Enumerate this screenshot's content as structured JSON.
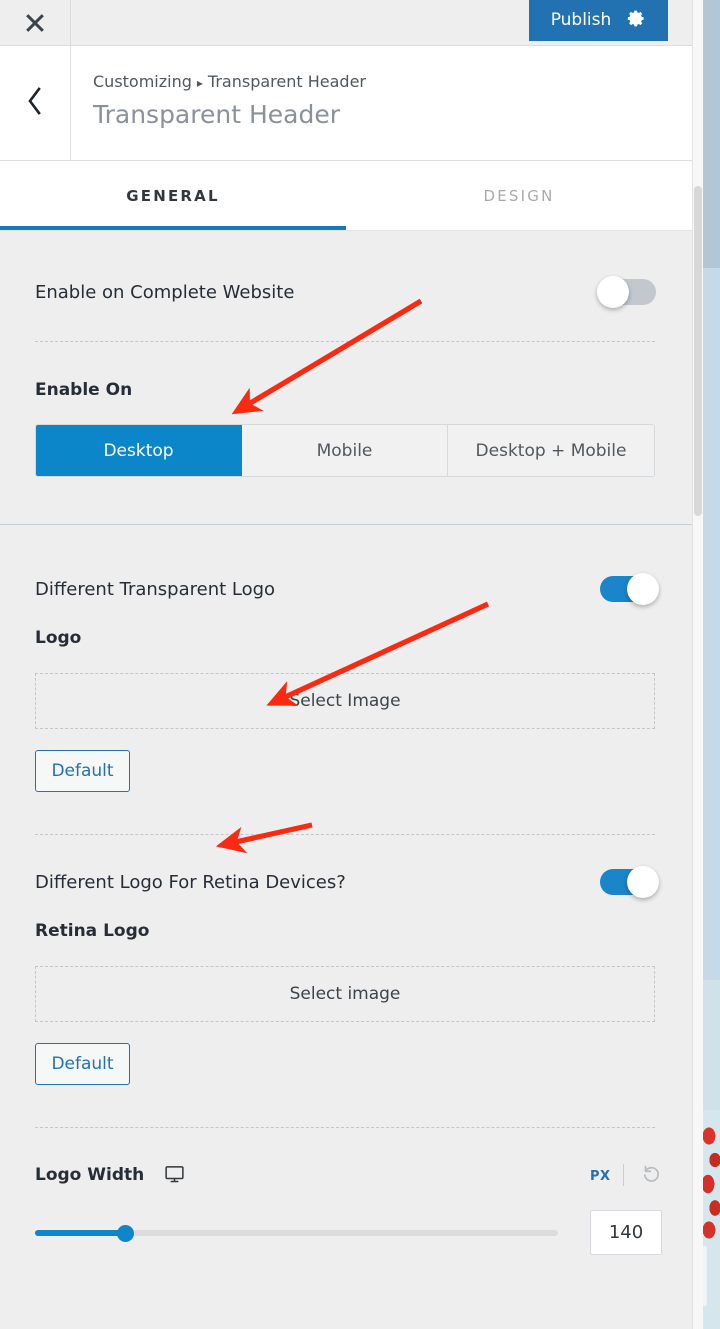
{
  "topbar": {
    "close_icon": "close-icon",
    "publish_label": "Publish",
    "gear_icon": "gear-icon"
  },
  "panel_header": {
    "back_icon": "chevron-left-icon",
    "breadcrumb_root": "Customizing",
    "breadcrumb_separator": "▸",
    "breadcrumb_current": "Transparent Header",
    "title": "Transparent Header"
  },
  "tabs": [
    {
      "label": "GENERAL",
      "active": true
    },
    {
      "label": "DESIGN",
      "active": false
    }
  ],
  "settings": {
    "enable_complete_website": {
      "label": "Enable on Complete Website",
      "toggle_state": "off"
    },
    "enable_on": {
      "label": "Enable On",
      "options": [
        "Desktop",
        "Mobile",
        "Desktop + Mobile"
      ],
      "selected": "Desktop"
    },
    "different_transparent_logo": {
      "label": "Different Transparent Logo",
      "toggle_state": "on",
      "logo_label": "Logo",
      "picker_text": "Select Image",
      "default_label": "Default"
    },
    "different_retina_logo": {
      "label": "Different Logo For Retina Devices?",
      "toggle_state": "on",
      "logo_label": "Retina Logo",
      "picker_text": "Select image",
      "default_label": "Default"
    },
    "logo_width": {
      "label": "Logo Width",
      "device_icon": "desktop-monitor-icon",
      "unit": "PX",
      "reset_icon": "reset-icon",
      "value": "140",
      "slider_min": 0,
      "slider_max": 600,
      "slider_percent": 17
    }
  },
  "colors": {
    "accent_blue": "#0e86c9",
    "publish_blue": "#2271b1",
    "tab_underline": "#1779ba",
    "annotation_red": "#f92a11",
    "panel_bg": "#eeeeee",
    "topbar_bg": "#eeeeee"
  },
  "annotations": [
    {
      "name": "arrow-to-enable-on-desktop"
    },
    {
      "name": "arrow-to-select-image"
    },
    {
      "name": "arrow-to-retina-toggle-row"
    }
  ]
}
